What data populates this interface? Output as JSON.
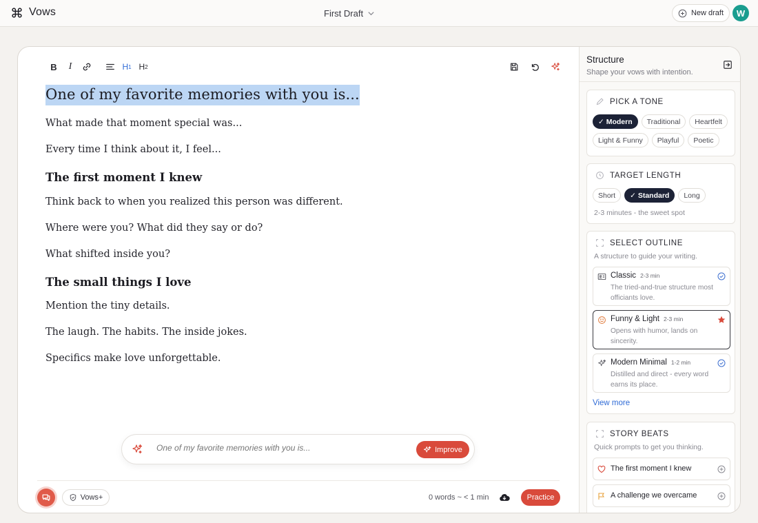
{
  "app": {
    "name": "Vows",
    "avatar_initial": "W"
  },
  "header": {
    "draft_name": "First Draft",
    "new_draft_label": "New draft"
  },
  "toolbar": {
    "bold": "B",
    "italic": "I",
    "h1": "H",
    "h1_sub": "1",
    "h2": "H",
    "h2_sub": "2"
  },
  "document": {
    "title": "One of my favorite memories with you is...",
    "lines": [
      "What made that moment special was...",
      "Every time I think about it, I feel...",
      "Think back to when you realized this person was different.",
      "Where were you? What did they say or do?",
      "What shifted inside you?",
      "Mention the tiny details.",
      "The laugh. The habits. The inside jokes.",
      "Specifics make love unforgettable."
    ],
    "headings": [
      "The first moment I knew",
      "The small things I love"
    ]
  },
  "improve": {
    "placeholder": "One of my favorite memories with you is...",
    "button_label": "Improve"
  },
  "footer": {
    "vows_plus_label": "Vows+",
    "word_count": "0 words ~ < 1 min",
    "practice_label": "Practice"
  },
  "sidebar": {
    "title": "Structure",
    "subtitle": "Shape your vows with intention.",
    "tone": {
      "title": "PICK A TONE",
      "options": [
        {
          "label": "✓ Modern",
          "active": true
        },
        {
          "label": "Traditional",
          "active": false
        },
        {
          "label": "Heartfelt",
          "active": false
        },
        {
          "label": "Light & Funny",
          "active": false
        },
        {
          "label": "Playful",
          "active": false
        },
        {
          "label": "Poetic",
          "active": false
        }
      ]
    },
    "length": {
      "title": "TARGET LENGTH",
      "options": [
        {
          "label": "Short",
          "active": false
        },
        {
          "label": "✓ Standard",
          "active": true
        },
        {
          "label": "Long",
          "active": false
        }
      ],
      "note": "2-3 minutes - the sweet spot"
    },
    "outline": {
      "title": "SELECT OUTLINE",
      "note": "A structure to guide your writing.",
      "items": [
        {
          "name": "Classic",
          "time": "2-3 min",
          "desc": "The tried-and-true structure most officiants love.",
          "icon": "id-card-icon",
          "mark": "check-circle-icon"
        },
        {
          "name": "Funny & Light",
          "time": "2-3 min",
          "desc": "Opens with humor, lands on sincerity.",
          "icon": "smile-icon",
          "mark": "star-icon"
        },
        {
          "name": "Modern Minimal",
          "time": "1-2 min",
          "desc": "Distilled and direct - every word earns its place.",
          "icon": "sparkle-icon",
          "mark": "check-circle-icon"
        }
      ],
      "view_more": "View more"
    },
    "beats": {
      "title": "STORY BEATS",
      "note": "Quick prompts to get you thinking.",
      "items": [
        {
          "label": "The first moment I knew",
          "icon": "heart-icon"
        },
        {
          "label": "A challenge we overcame",
          "icon": "flag-icon"
        }
      ]
    }
  },
  "colors": {
    "accent": "#d94a3b",
    "link": "#2f6bd6",
    "dark_chip": "#1c2236",
    "highlight": "#bcd6f4",
    "avatar": "#1a9d8f"
  }
}
